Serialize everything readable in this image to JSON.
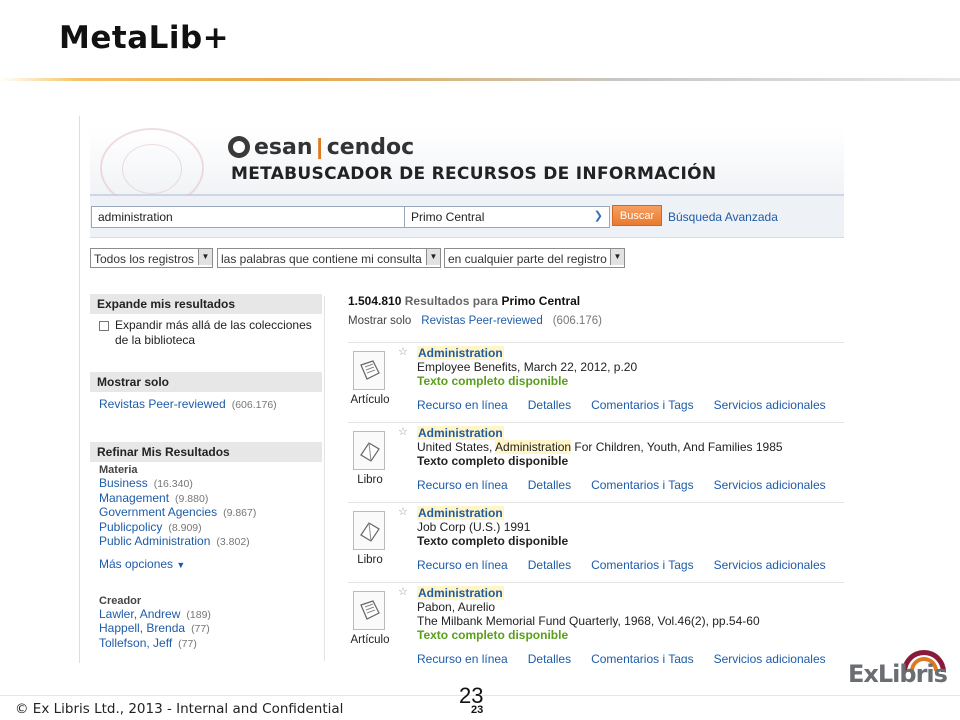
{
  "slide": {
    "title": "MetaLib+",
    "footer": "© Ex Libris Ltd., 2013 - Internal and Confidential",
    "page_number": "23",
    "page_number_small": "23",
    "logo": "ExLibris"
  },
  "banner": {
    "brand_left": "esan",
    "brand_sep": "|",
    "brand_right": "cendoc",
    "subtitle": "METABUSCADOR DE RECURSOS DE INFORMACIÓN"
  },
  "search": {
    "query": "administration",
    "scope": "Primo Central",
    "button": "Buscar",
    "advanced": "Búsqueda Avanzada"
  },
  "filters": [
    "Todos los registros",
    "las palabras que contiene mi consulta",
    "en cualquier parte del registro"
  ],
  "facets": {
    "expand_head": "Expande mis resultados",
    "expand_label": "Expandir más allá de las colecciones de la biblioteca",
    "show_only_head": "Mostrar solo",
    "show_only_link": "Revistas Peer-reviewed",
    "show_only_count": "(606.176)",
    "refine_head": "Refinar Mis Resultados",
    "materia_label": "Materia",
    "materia": [
      {
        "label": "Business",
        "count": "(16.340)"
      },
      {
        "label": "Management",
        "count": "(9.880)"
      },
      {
        "label": "Government Agencies",
        "count": "(9.867)"
      },
      {
        "label": "Publicpolicy",
        "count": "(8.909)"
      },
      {
        "label": "Public Administration",
        "count": "(3.802)"
      }
    ],
    "more_options": "Más opciones",
    "creador_label": "Creador",
    "creador": [
      {
        "label": "Lawler, Andrew",
        "count": "(189)"
      },
      {
        "label": "Happell, Brenda",
        "count": "(77)"
      },
      {
        "label": "Tollefson, Jeff",
        "count": "(77)"
      }
    ]
  },
  "results_header": {
    "count": "1.504.810",
    "label": "Resultados para",
    "source": "Primo Central",
    "show_only_label": "Mostrar solo",
    "show_only_link": "Revistas Peer-reviewed",
    "show_only_count": "(606.176)"
  },
  "actions": {
    "online": "Recurso en línea",
    "details": "Detalles",
    "comments": "Comentarios i Tags",
    "services": "Servicios adicionales"
  },
  "records": [
    {
      "type": "Artículo",
      "title": "Administration",
      "line1": "Employee Benefits, March 22, 2012, p.20",
      "availability": "Texto completo disponible"
    },
    {
      "type": "Libro",
      "title": "Administration",
      "line1_pre": "United States, ",
      "line1_hl": "Administration",
      "line1_post": " For Children, Youth, And Families 1985",
      "availability": "Texto completo disponible"
    },
    {
      "type": "Libro",
      "title": "Administration",
      "line1": "Job Corp (U.S.) 1991",
      "availability": "Texto completo disponible"
    },
    {
      "type": "Artículo",
      "title": "Administration",
      "line1": "Pabon, Aurelio",
      "line2": "The Milbank Memorial Fund Quarterly, 1968, Vol.46(2), pp.54-60",
      "availability": "Texto completo disponible"
    }
  ],
  "colors": {
    "link": "#1e5ca8",
    "available": "#5a9e1c",
    "button": "#e97a2f",
    "highlight": "#fff5c8"
  }
}
